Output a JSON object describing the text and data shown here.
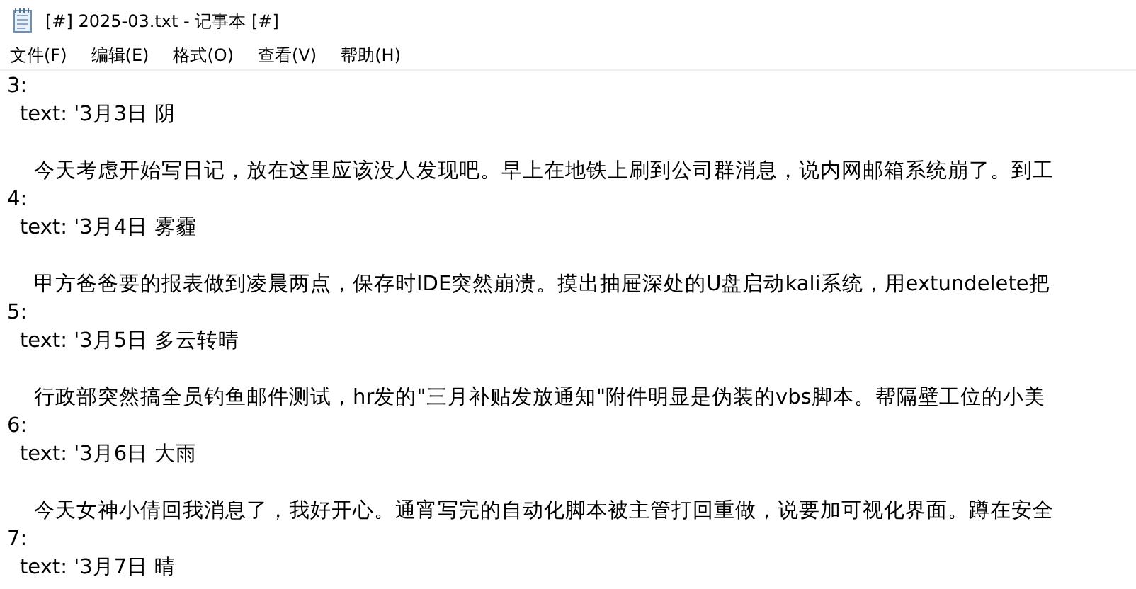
{
  "window": {
    "title": "[#] 2025-03.txt - 记事本 [#]"
  },
  "menu": [
    "文件(F)",
    "编辑(E)",
    "格式(O)",
    "查看(V)",
    "帮助(H)"
  ],
  "lines": [
    {
      "kind": "key",
      "text": "3:"
    },
    {
      "kind": "value",
      "text": "text: '3月3日 阴"
    },
    {
      "kind": "body",
      "text": "今天考虑开始写日记，放在这里应该没人发现吧。早上在地铁上刷到公司群消息，说内网邮箱系统崩了。到工"
    },
    {
      "kind": "key",
      "text": "4:"
    },
    {
      "kind": "value",
      "text": "text: '3月4日 雾霾"
    },
    {
      "kind": "body",
      "text": "甲方爸爸要的报表做到凌晨两点，保存时IDE突然崩溃。摸出抽屉深处的U盘启动kali系统，用extundelete把"
    },
    {
      "kind": "key",
      "text": "5:"
    },
    {
      "kind": "value",
      "text": "text: '3月5日 多云转晴"
    },
    {
      "kind": "body",
      "text": "行政部突然搞全员钓鱼邮件测试，hr发的\"三月补贴发放通知\"附件明显是伪装的vbs脚本。帮隔壁工位的小美"
    },
    {
      "kind": "key",
      "text": "6:"
    },
    {
      "kind": "value",
      "text": "text: '3月6日 大雨"
    },
    {
      "kind": "body",
      "text": "今天女神小倩回我消息了，我好开心。通宵写完的自动化脚本被主管打回重做，说要加可视化界面。蹲在安全"
    },
    {
      "kind": "key",
      "text": "7:"
    },
    {
      "kind": "value",
      "text": "text: '3月7日 晴"
    }
  ]
}
